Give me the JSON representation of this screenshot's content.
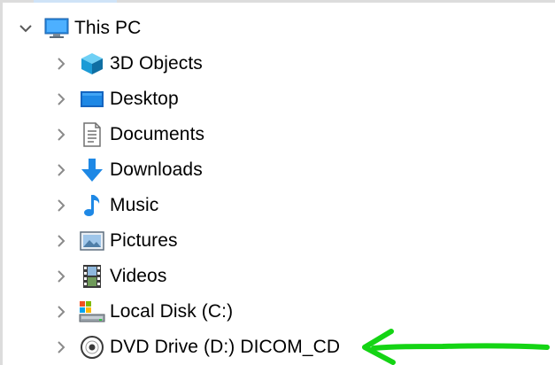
{
  "tree": {
    "root": {
      "label": "This PC",
      "icon": "monitor-icon",
      "expanded": true
    },
    "items": [
      {
        "label": "3D Objects",
        "icon": "3d-objects-icon",
        "expanded": false
      },
      {
        "label": "Desktop",
        "icon": "desktop-icon",
        "expanded": false
      },
      {
        "label": "Documents",
        "icon": "documents-icon",
        "expanded": false
      },
      {
        "label": "Downloads",
        "icon": "downloads-icon",
        "expanded": false
      },
      {
        "label": "Music",
        "icon": "music-icon",
        "expanded": false
      },
      {
        "label": "Pictures",
        "icon": "pictures-icon",
        "expanded": false
      },
      {
        "label": "Videos",
        "icon": "videos-icon",
        "expanded": false
      },
      {
        "label": "Local Disk (C:)",
        "icon": "hard-drive-icon",
        "expanded": false
      },
      {
        "label": "DVD Drive (D:) DICOM_CD",
        "icon": "dvd-drive-icon",
        "expanded": false
      }
    ]
  },
  "annotation": {
    "icon": "green-arrow-icon",
    "color": "#14d414"
  },
  "colors": {
    "accent_blue": "#1e88e5",
    "chevron": "#8a8a8a"
  }
}
